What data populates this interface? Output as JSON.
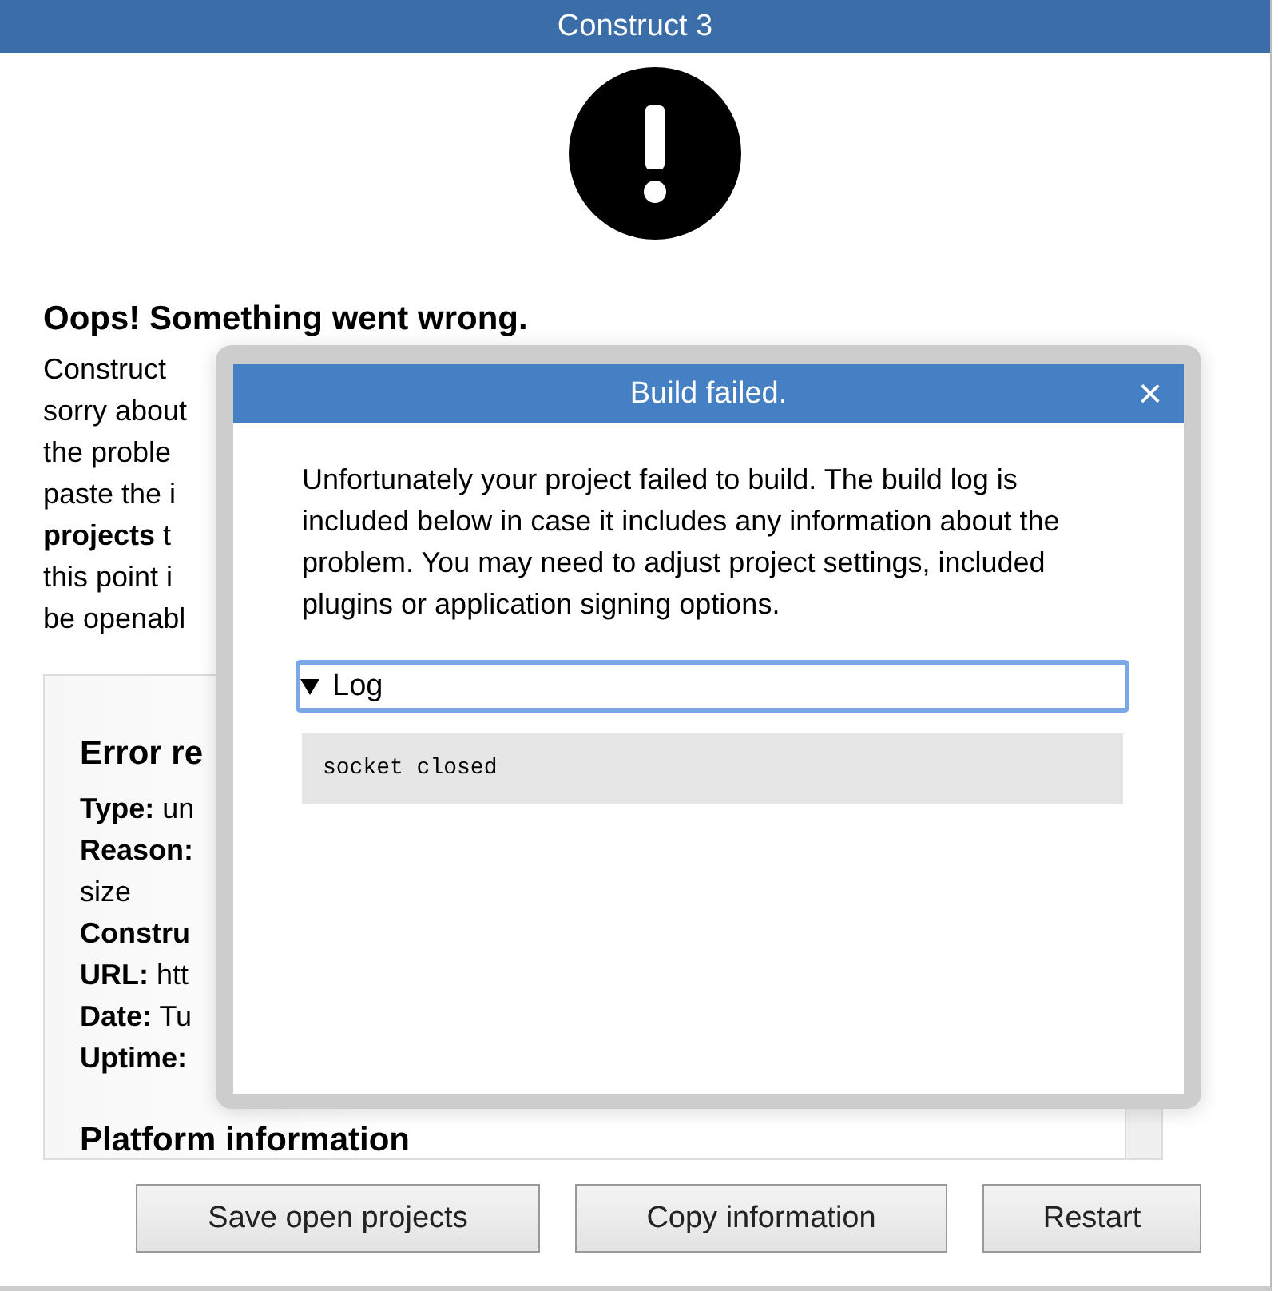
{
  "window": {
    "title": "Construct 3"
  },
  "error_page": {
    "heading": "Oops! Something went wrong.",
    "paragraph_lines": [
      "Construct",
      "sorry about",
      "the proble",
      "paste the i",
      "**projects** t",
      "this point i",
      "be openabl"
    ],
    "report": {
      "heading": "Error re",
      "lines": [
        "**Type:** un",
        "**Reason:**",
        "size",
        "**Constru**",
        "**URL:** htt",
        "**Date:** Tu",
        "**Uptime:**"
      ],
      "next_heading": "Platform information"
    }
  },
  "buttons": [
    "Save open projects",
    "Copy information",
    "Restart"
  ],
  "dialog": {
    "title": "Build failed.",
    "close": "×",
    "message": "Unfortunately your project failed to build. The build log is included below in case it includes any information about the problem. You may need to adjust project settings, included plugins or application signing options.",
    "log": {
      "label": "Log",
      "expanded": true,
      "content": "socket closed"
    }
  }
}
